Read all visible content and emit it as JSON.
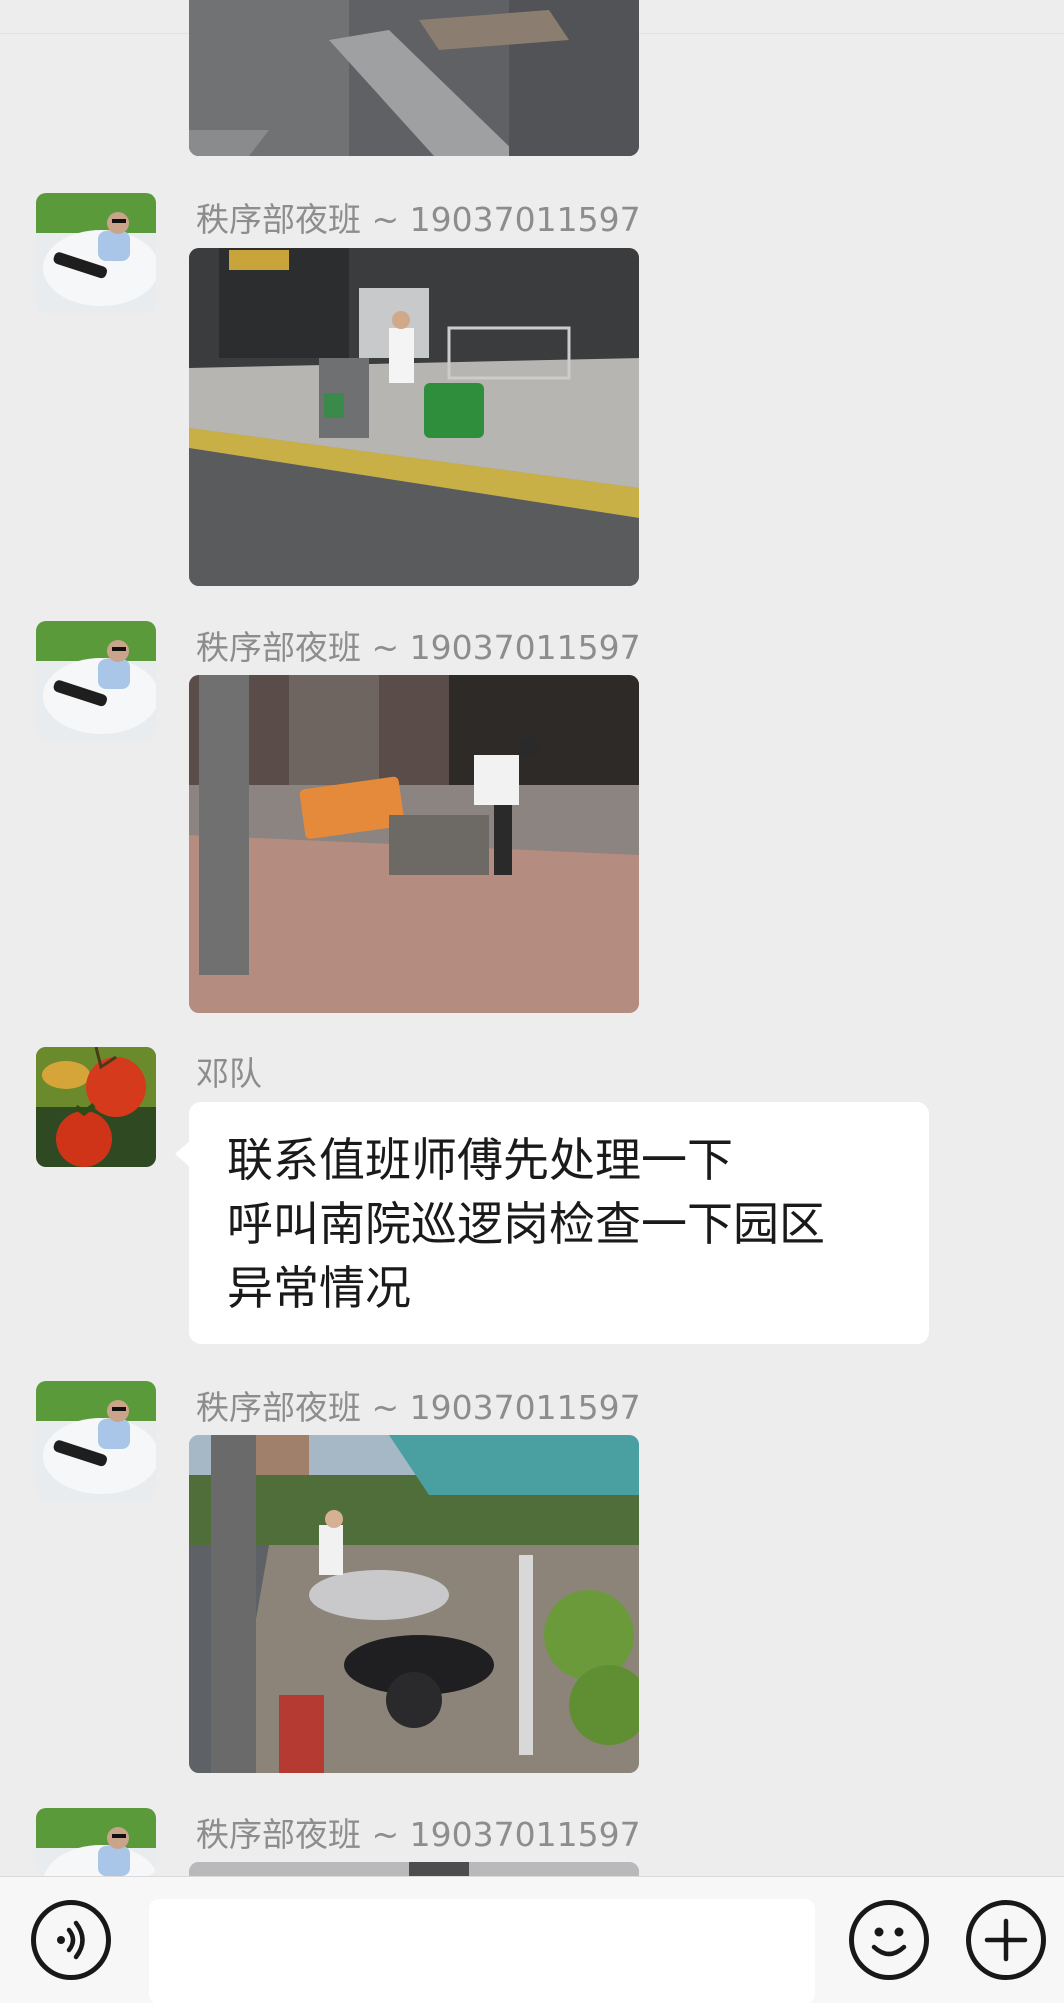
{
  "chat": {
    "messages": [
      {
        "type": "image",
        "sender": "",
        "image": "photo-street-corner-partial"
      },
      {
        "type": "image",
        "sender": "秩序部夜班 ~ 19037011597",
        "avatar": "avatar-man-lying-on-chair",
        "image": "photo-guard-moving-green-bins"
      },
      {
        "type": "image",
        "sender": "秩序部夜班 ~ 19037011597",
        "avatar": "avatar-man-lying-on-chair",
        "image": "photo-guard-orange-bin-knocked-over"
      },
      {
        "type": "text",
        "sender": "邓队",
        "avatar": "avatar-persimmons",
        "lines": [
          "联系值班师傅先处理一下",
          "呼叫南院巡逻岗检查一下园区",
          "异常情况"
        ]
      },
      {
        "type": "image",
        "sender": "秩序部夜班 ~ 19037011597",
        "avatar": "avatar-man-lying-on-chair",
        "image": "photo-guard-fallen-motorbikes"
      },
      {
        "type": "image",
        "sender": "秩序部夜班 ~ 19037011597",
        "avatar": "avatar-man-lying-on-chair",
        "image": "photo-partial"
      }
    ]
  },
  "input_bar": {
    "voice_icon": "voice-icon",
    "text_value": "",
    "emoji_icon": "emoji-icon",
    "plus_icon": "plus-icon"
  }
}
